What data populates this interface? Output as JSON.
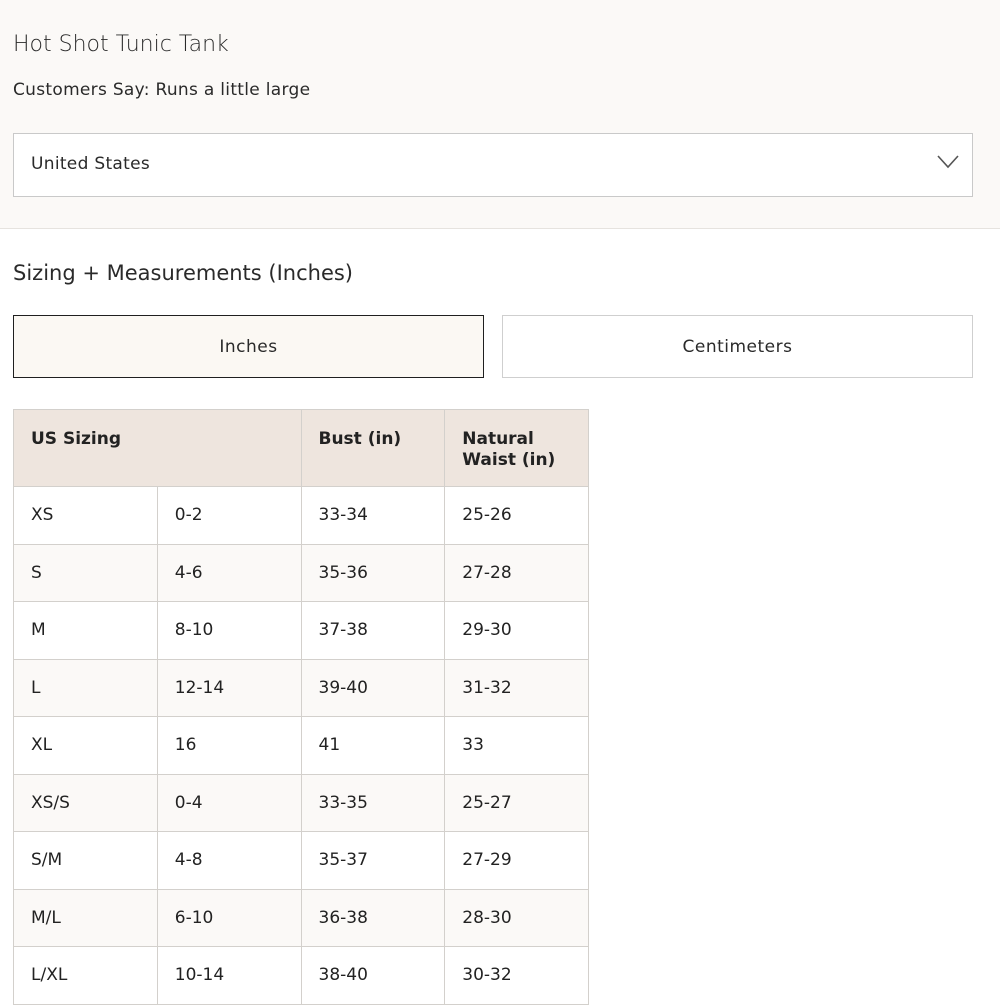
{
  "product": {
    "title": "Hot Shot Tunic Tank",
    "fit_note": "Customers Say: Runs a little large"
  },
  "country_select": {
    "value": "United States",
    "icon": "chevron-down-icon"
  },
  "sizing": {
    "title": "Sizing + Measurements (Inches)",
    "units": {
      "active": "Inches",
      "inactive": "Centimeters"
    }
  },
  "table": {
    "headers": {
      "us_sizing": "US Sizing",
      "bust": "Bust (in)",
      "waist": "Natural Waist (in)"
    },
    "rows": [
      [
        "XS",
        "0-2",
        "33-34",
        "25-26"
      ],
      [
        "S",
        "4-6",
        "35-36",
        "27-28"
      ],
      [
        "M",
        "8-10",
        "37-38",
        "29-30"
      ],
      [
        "L",
        "12-14",
        "39-40",
        "31-32"
      ],
      [
        "XL",
        "16",
        "41",
        "33"
      ],
      [
        "XS/S",
        "0-4",
        "33-35",
        "25-27"
      ],
      [
        "S/M",
        "4-8",
        "35-37",
        "27-29"
      ],
      [
        "M/L",
        "6-10",
        "36-38",
        "28-30"
      ],
      [
        "L/XL",
        "10-14",
        "38-40",
        "30-32"
      ]
    ]
  },
  "colors": {
    "header_bg": "#eee5de",
    "panel_bg": "#fbf9f7",
    "active_border": "#1f1f1f"
  }
}
